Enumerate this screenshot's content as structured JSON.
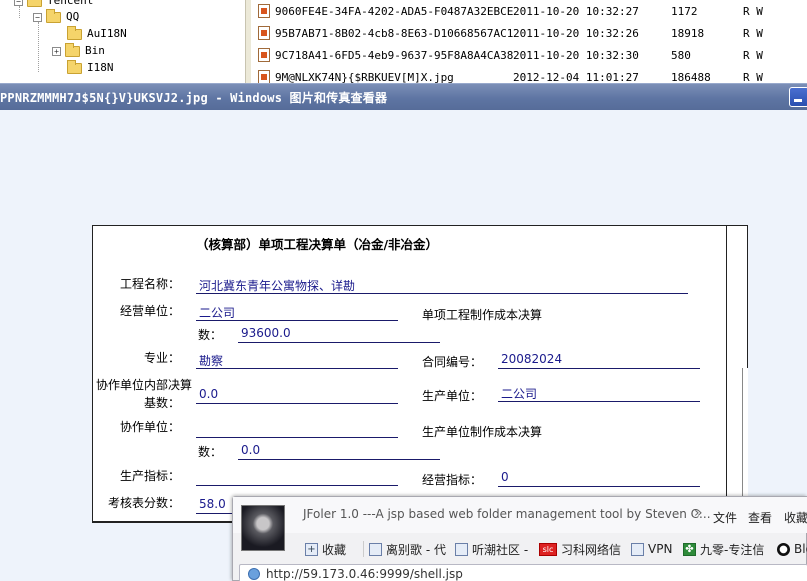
{
  "explorer": {
    "tree": [
      {
        "label": "Tencent",
        "expander": "−"
      },
      {
        "label": "QQ",
        "expander": "−"
      },
      {
        "label": "AuI18N",
        "expander": ""
      },
      {
        "label": "Bin",
        "expander": "+"
      },
      {
        "label": "I18N",
        "expander": ""
      }
    ],
    "files": [
      {
        "name": "9060FE4E-34FA-4202-ADA5-F0487A32EBCE...",
        "date": "2011-10-20 10:32:27",
        "size": "1172",
        "attr": "R W"
      },
      {
        "name": "95B7AB71-8B02-4cb8-8E63-D10668567AC1...",
        "date": "2011-10-20 10:32:26",
        "size": "18918",
        "attr": "R W"
      },
      {
        "name": "9C718A41-6FD5-4eb9-9637-95F8A8A4CA38...",
        "date": "2011-10-20 10:32:30",
        "size": "580",
        "attr": "R W"
      },
      {
        "name": "9M@NLXK74N}{$RBKUEV[M]X.jpg",
        "date": "2012-12-04 11:01:27",
        "size": "186488",
        "attr": "R W"
      }
    ]
  },
  "viewer": {
    "title": "PPNRZMMMH7J$5N{}V}UKSVJ2.jpg - Windows 图片和传真查看器"
  },
  "document": {
    "title": "（核算部）单项工程决算单（冶金/非冶金）",
    "project_name_label": "工程名称：",
    "project_name_value": "河北冀东青年公寓物探、详勘",
    "operating_unit_label": "经营单位：",
    "operating_unit_value": "二公司",
    "cost_settlement_label": "单项工程制作成本决算",
    "count_label": "数：",
    "count_value": "93600.0",
    "specialty_label": "专业：",
    "specialty_value": "勘察",
    "contract_no_label": "合同编号：",
    "contract_no_value": "20082024",
    "coop_internal_label_line1": "协作单位内部决算",
    "coop_internal_label_line2": "基数：",
    "coop_internal_value": "0.0",
    "production_unit_label": "生产单位：",
    "production_unit_value": "二公司",
    "coop_unit_label": "协作单位：",
    "coop_unit_value": "",
    "production_cost_label": "生产单位制作成本决算",
    "count2_label": "数：",
    "count2_value": "0.0",
    "production_index_label": "生产指标：",
    "production_index_value": "",
    "operating_index_label": "经营指标：",
    "operating_index_value": "0",
    "assessment_score_label": "考核表分数：",
    "assessment_score_value": "58.0"
  },
  "browser": {
    "tab_title": "JFoler 1.0 ---A jsp based web folder management tool by Steven C...",
    "chevron": "»",
    "menu": [
      "文件",
      "查看",
      "收藏"
    ],
    "bookmarks": [
      "收藏",
      "离别歌 - 代",
      "听潮社区 -",
      "习科网络信",
      "VPN",
      "九零-专注信",
      "Blo"
    ],
    "bookmark_icons": [
      "plus-icon",
      "page-icon",
      "page-icon",
      "slc-icon",
      "page-icon",
      "leaf-icon",
      "github-icon"
    ],
    "url": "http://59.173.0.46:9999/shell.jsp"
  }
}
